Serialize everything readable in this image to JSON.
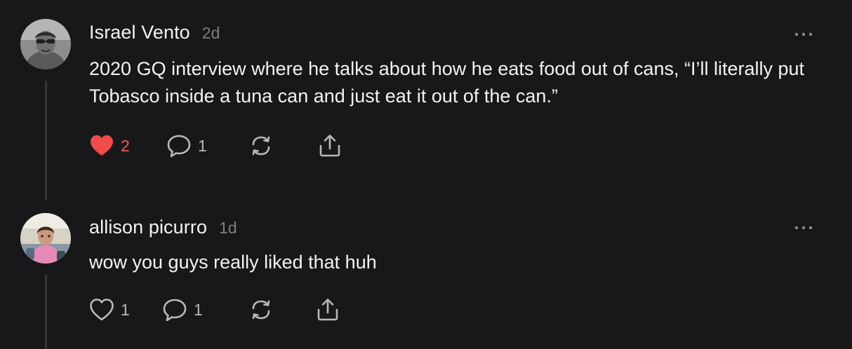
{
  "replies": [
    {
      "username": "Israel Vento",
      "timestamp": "2d",
      "text": "2020 GQ interview where he talks about how he eats food out of cans, “I’ll literally put Tobasco inside a tuna can and just eat it out of the can.”",
      "liked": true,
      "like_count": "2",
      "reply_count": "1",
      "avatar": "avatar-photo-man-sunglasses"
    },
    {
      "username": "allison picurro",
      "timestamp": "1d",
      "text": "wow you guys really liked that huh",
      "liked": false,
      "like_count": "1",
      "reply_count": "1",
      "avatar": "avatar-photo-child-pink"
    }
  ],
  "icons": {
    "like_filled": "heart-filled-icon",
    "like_outline": "heart-outline-icon",
    "reply": "speech-bubble-icon",
    "repost": "repost-icon",
    "share": "share-upload-icon",
    "more": "ellipsis-icon"
  },
  "colors": {
    "background": "#18181a",
    "text": "#f3f3f5",
    "muted": "#7c7c82",
    "like_active": "#f15a5a",
    "thread_line": "#36363a"
  }
}
